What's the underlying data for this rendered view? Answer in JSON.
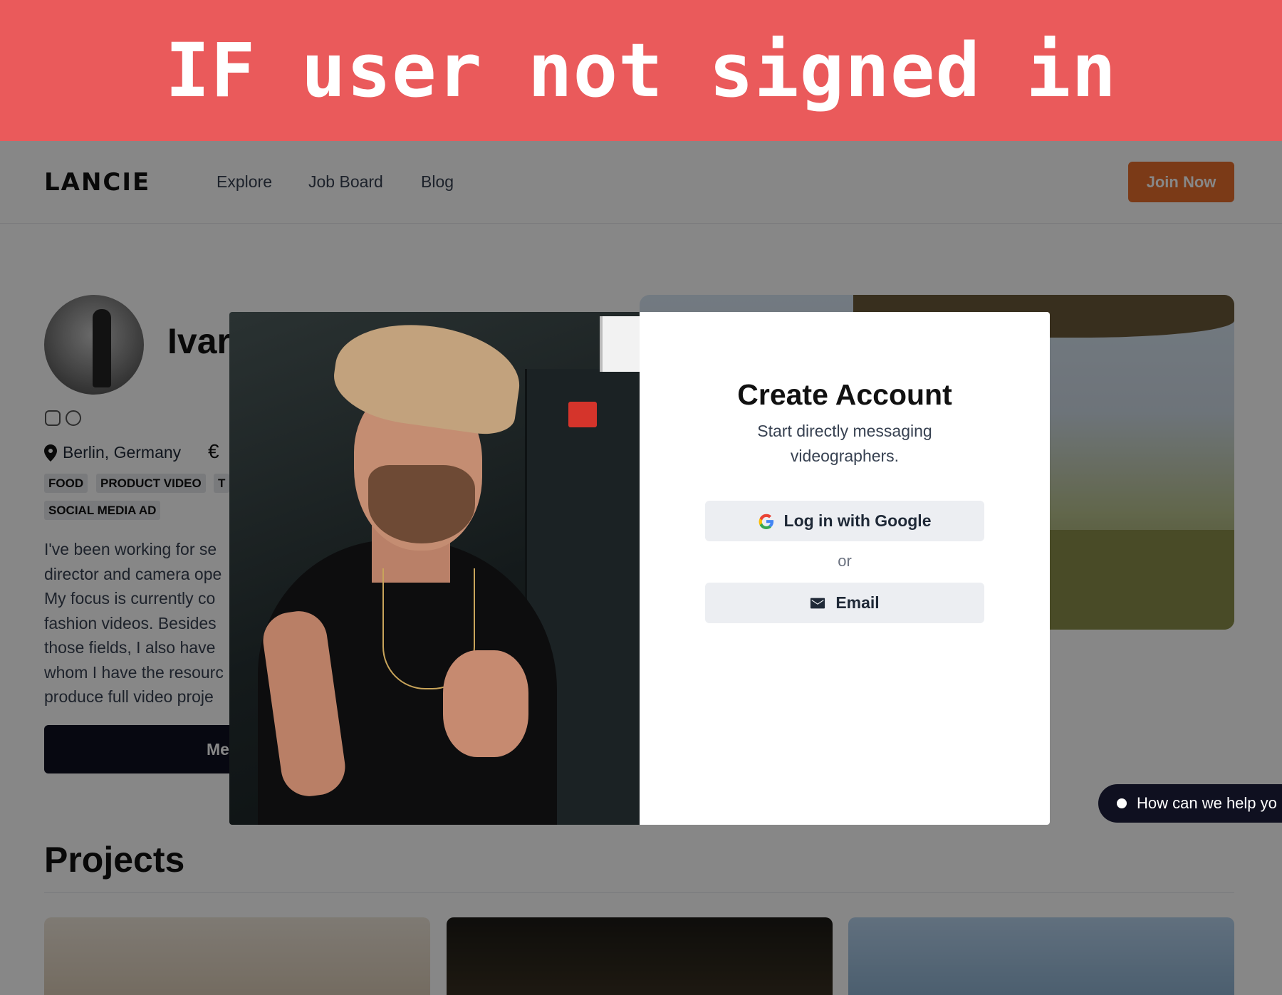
{
  "banner": {
    "text": "IF user not signed in",
    "color": "#ea5a5b"
  },
  "nav": {
    "logo": "LANCIE",
    "links": [
      "Explore",
      "Job Board",
      "Blog"
    ],
    "join_label": "Join Now",
    "join_color": "#e86f2c"
  },
  "profile": {
    "name_visible": "Ivar",
    "location": "Berlin, Germany",
    "currency_symbol": "€",
    "tags": [
      "FOOD",
      "PRODUCT VIDEO",
      "T",
      "SOCIAL MEDIA AD"
    ],
    "bio_lines": [
      "I've been working for se",
      "director and camera ope",
      "My focus is currently co",
      "fashion videos. Besides",
      "those fields, I also have",
      "whom I have the resourc",
      "produce full video proje"
    ],
    "message_label_visible": "Me",
    "social_icons": [
      "instagram-icon",
      "globe-icon"
    ]
  },
  "projects": {
    "title": "Projects"
  },
  "help_chip": {
    "label": "How can we help yo"
  },
  "modal": {
    "title": "Create Account",
    "subtitle": "Start directly messaging videographers.",
    "google_label": "Log in with Google",
    "or_label": "or",
    "email_label": "Email",
    "icons": {
      "google": "google-icon",
      "email": "mail-icon"
    }
  }
}
